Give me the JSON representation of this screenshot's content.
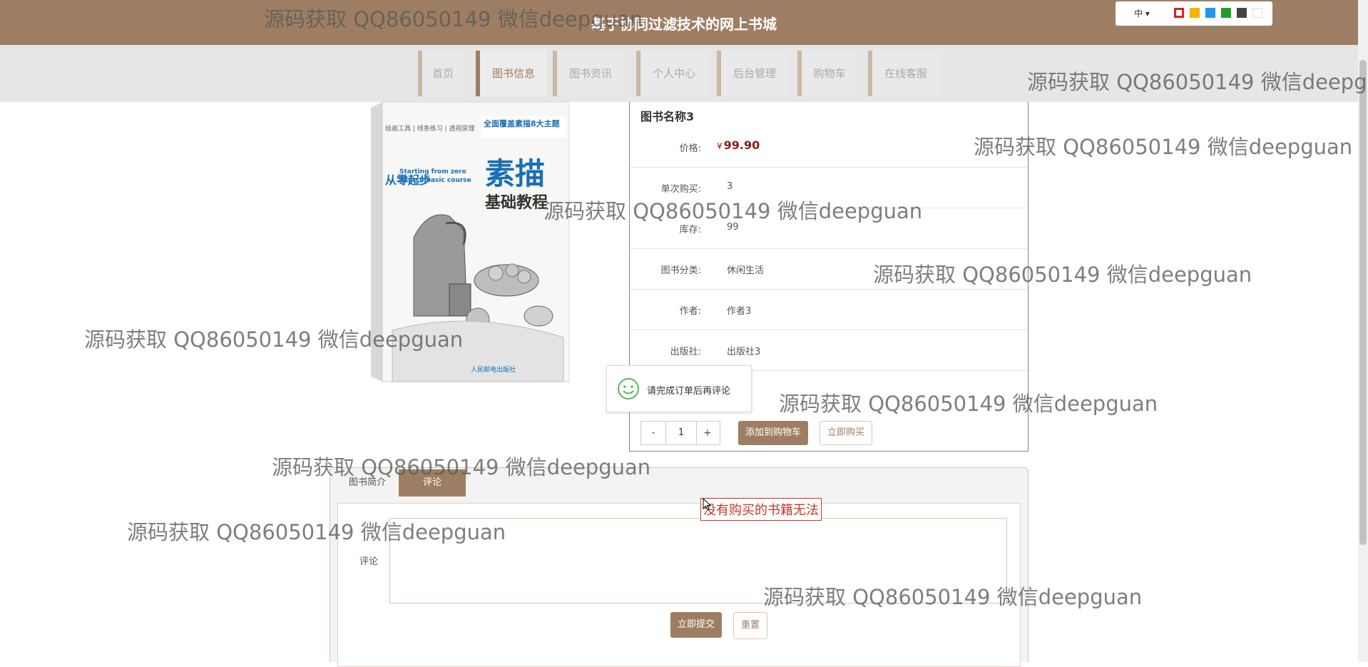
{
  "site": {
    "title": "基于协同过滤技术的网上书城"
  },
  "toolbar": {
    "language": "中",
    "language_caret": "▾",
    "theme_colors": [
      "#e02020",
      "#f5b400",
      "#2196f3",
      "#20a020",
      "#444444",
      "#ffffff"
    ]
  },
  "nav": {
    "items": [
      {
        "label": "首页"
      },
      {
        "label": "图书信息"
      },
      {
        "label": "图书资讯"
      },
      {
        "label": "个人中心"
      },
      {
        "label": "后台管理"
      },
      {
        "label": "购物车"
      },
      {
        "label": "在线客服"
      }
    ],
    "active_index": 1
  },
  "cover": {
    "series": "从零起步",
    "title_big": "素描",
    "title_sub": "基础教程",
    "en_line1": "Starting from zero",
    "en_line2": "Sketch basic course",
    "badge": "全面覆盖素描8大主题",
    "publisher": "人民邮电出版社"
  },
  "book": {
    "name": "图书名称3",
    "currency": "¥",
    "price": "99.90",
    "fields": [
      {
        "label": "价格:",
        "value": ""
      },
      {
        "label": "单次购买:",
        "value": "3"
      },
      {
        "label": "库存:",
        "value": "99"
      },
      {
        "label": "图书分类:",
        "value": "休闲生活"
      },
      {
        "label": "作者:",
        "value": "作者3"
      },
      {
        "label": "出版社:",
        "value": "出版社3"
      }
    ]
  },
  "purchase": {
    "minus": "-",
    "qty": "1",
    "plus": "+",
    "add_to_cart": "添加到购物车",
    "buy_now": "立即购买"
  },
  "toast": {
    "message": "请完成订单后再评论"
  },
  "tabs": {
    "intro": "图书简介",
    "comment": "评论"
  },
  "comment": {
    "label": "评论",
    "submit": "立即提交",
    "reset": "重置",
    "warning": "没有购买的书籍无法"
  },
  "watermark": {
    "text": "源码获取 QQ86050149 微信deepguan"
  }
}
